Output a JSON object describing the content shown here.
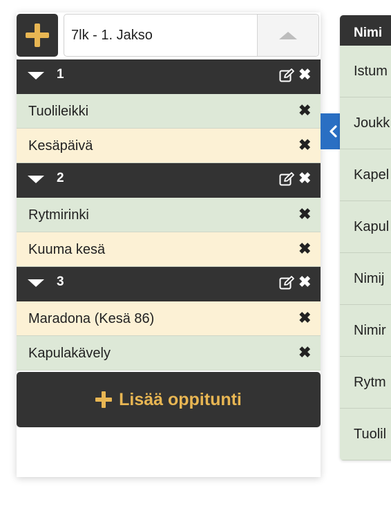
{
  "header": {
    "add_icon": "plus-icon",
    "period_select": {
      "value": "7lk - 1. Jakso",
      "icon": "caret-up-icon"
    }
  },
  "groups": [
    {
      "number": "1",
      "lessons": [
        {
          "name": "Tuolileikki",
          "status": "green"
        },
        {
          "name": "Kesäpäivä",
          "status": "yellow"
        }
      ]
    },
    {
      "number": "2",
      "lessons": [
        {
          "name": "Rytmirinki",
          "status": "green"
        },
        {
          "name": "Kuuma kesä",
          "status": "yellow"
        }
      ]
    },
    {
      "number": "3",
      "lessons": [
        {
          "name": "Maradona (Kesä 86)",
          "status": "yellow"
        },
        {
          "name": "Kapulakävely",
          "status": "green"
        }
      ]
    }
  ],
  "add_lesson_label": "Lisää oppitunti",
  "remove_glyph": "✖",
  "colors": {
    "dark": "#333333",
    "accent": "#e8b653",
    "green_row": "#dde8d7",
    "yellow_row": "#fcf1d5",
    "toggle_blue": "#2a6fc3"
  },
  "table": {
    "column_header": "Nimi",
    "rows": [
      "Istum",
      "Joukk",
      "Kapel",
      "Kapul",
      "Nimij",
      "Nimir",
      "Rytm",
      "Tuolil"
    ]
  }
}
